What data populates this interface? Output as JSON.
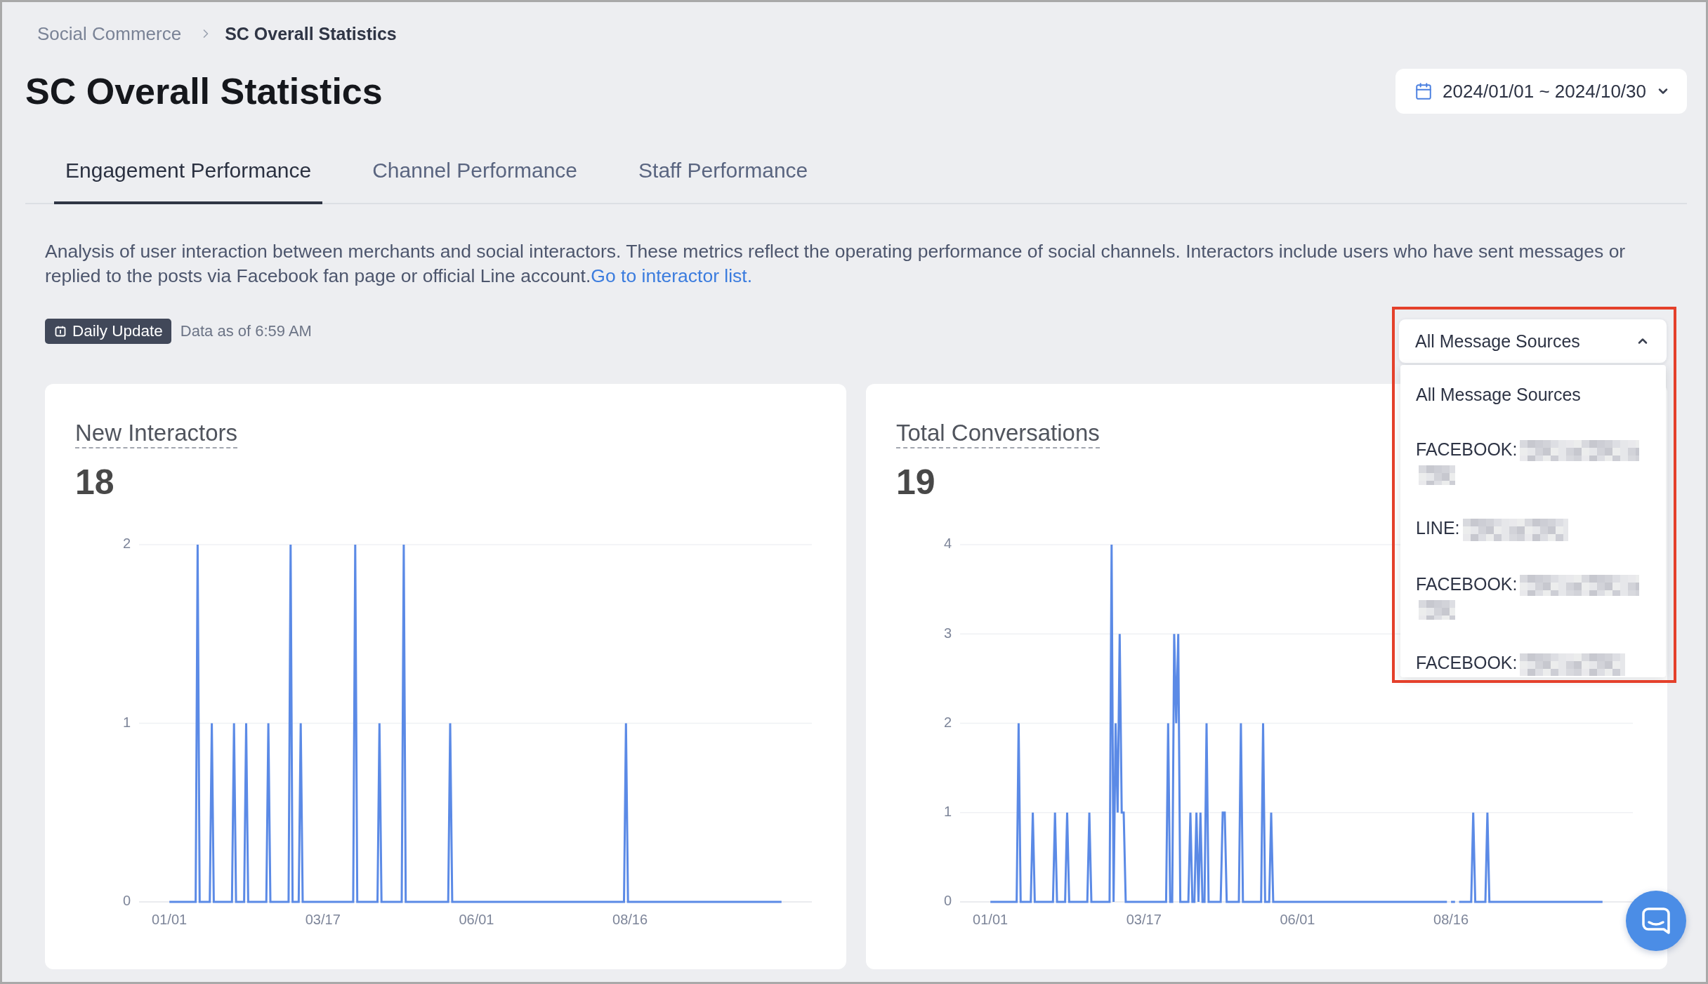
{
  "breadcrumb": [
    {
      "label": "Social Commerce",
      "current": false
    },
    {
      "label": "SC Overall Statistics",
      "current": true
    }
  ],
  "page_title": "SC Overall Statistics",
  "date_range": {
    "value": "2024/01/01 ~ 2024/10/30"
  },
  "tabs": [
    {
      "label": "Engagement Performance",
      "selected": true
    },
    {
      "label": "Channel Performance",
      "selected": false
    },
    {
      "label": "Staff Performance",
      "selected": false
    }
  ],
  "description": {
    "text": "Analysis of user interaction between merchants and social interactors. These metrics reflect the operating performance of social channels. Interactors include users who have sent messages or replied to the posts via Facebook fan page or official Line account.",
    "link": "Go to interactor list."
  },
  "update_badge": {
    "label": "Daily Update"
  },
  "data_timestamp": "Data as of 6:59 AM",
  "source_filter": {
    "value": "All Message Sources",
    "expanded": true,
    "highlighted": true,
    "options": [
      {
        "label": "All Message Sources",
        "kind": "plain"
      },
      {
        "label": "FACEBOOK:",
        "kind": "masked-wrapped"
      },
      {
        "label": "LINE:",
        "kind": "masked"
      },
      {
        "label": "FACEBOOK:",
        "kind": "masked-wrapped"
      },
      {
        "label": "FACEBOOK:",
        "kind": "masked"
      }
    ]
  },
  "metrics": [
    {
      "title": "New Interactors",
      "value": "18",
      "chart_data": {
        "type": "line",
        "color": "#5b8ae6",
        "grid": true,
        "xlim": [
          "2023-12-17",
          "2024-11-14"
        ],
        "ylim": [
          0,
          2
        ],
        "yticks": [
          0,
          1,
          2
        ],
        "xticks": [
          {
            "value": "2024-01-01",
            "label": "01/01"
          },
          {
            "value": "2024-03-17",
            "label": "03/17"
          },
          {
            "value": "2024-06-01",
            "label": "06/01"
          },
          {
            "value": "2024-08-16",
            "label": "08/16"
          }
        ],
        "x": [
          "2024-01-01",
          "2024-01-14",
          "2024-01-15",
          "2024-01-16",
          "2024-01-21",
          "2024-01-22",
          "2024-01-23",
          "2024-02-01",
          "2024-02-02",
          "2024-02-03",
          "2024-02-07",
          "2024-02-08",
          "2024-02-09",
          "2024-02-18",
          "2024-02-19",
          "2024-02-20",
          "2024-02-29",
          "2024-03-01",
          "2024-03-02",
          "2024-03-05",
          "2024-03-06",
          "2024-03-07",
          "2024-04-01",
          "2024-04-02",
          "2024-04-03",
          "2024-04-13",
          "2024-04-14",
          "2024-04-15",
          "2024-04-25",
          "2024-04-26",
          "2024-04-27",
          "2024-05-18",
          "2024-05-19",
          "2024-05-20",
          "2024-08-13",
          "2024-08-14",
          "2024-08-15",
          "2024-10-30"
        ],
        "values": [
          0,
          0,
          2,
          0,
          0,
          1,
          0,
          0,
          1,
          0,
          0,
          1,
          0,
          0,
          1,
          0,
          0,
          2,
          0,
          0,
          1,
          0,
          0,
          2,
          0,
          0,
          1,
          0,
          0,
          2,
          0,
          0,
          1,
          0,
          0,
          1,
          0,
          0
        ]
      }
    },
    {
      "title": "Total Conversations",
      "value": "19",
      "chart_data": {
        "type": "line",
        "color": "#5b8ae6",
        "grid": true,
        "xlim": [
          "2023-12-17",
          "2024-11-14"
        ],
        "ylim": [
          0,
          4
        ],
        "yticks": [
          0,
          1,
          2,
          3,
          4
        ],
        "xticks": [
          {
            "value": "2024-01-01",
            "label": "01/01"
          },
          {
            "value": "2024-03-17",
            "label": "03/17"
          },
          {
            "value": "2024-06-01",
            "label": "06/01"
          },
          {
            "value": "2024-08-16",
            "label": "08/16"
          }
        ],
        "x": [
          "2024-01-01",
          "2024-01-14",
          "2024-01-15",
          "2024-01-16",
          "2024-01-21",
          "2024-01-22",
          "2024-01-23",
          "2024-02-01",
          "2024-02-02",
          "2024-02-03",
          "2024-02-07",
          "2024-02-08",
          "2024-02-09",
          "2024-02-18",
          "2024-02-19",
          "2024-02-20",
          "2024-02-29",
          "2024-03-01",
          "2024-03-02",
          "2024-03-03",
          "2024-03-04",
          "2024-03-05",
          "2024-03-06",
          "2024-03-07",
          "2024-03-08",
          "2024-03-28",
          "2024-03-29",
          "2024-03-30",
          "2024-03-31",
          "2024-04-01",
          "2024-04-02",
          "2024-04-03",
          "2024-04-04",
          "2024-04-08",
          "2024-04-09",
          "2024-04-10",
          "2024-04-11",
          "2024-04-12",
          "2024-04-13",
          "2024-04-14",
          "2024-04-15",
          "2024-04-16",
          "2024-04-17",
          "2024-04-18",
          "2024-04-24",
          "2024-04-25",
          "2024-04-26",
          "2024-04-27",
          "2024-05-03",
          "2024-05-04",
          "2024-05-05",
          "2024-05-14",
          "2024-05-15",
          "2024-05-16",
          "2024-05-18",
          "2024-05-19",
          "2024-05-20",
          "2024-08-14",
          "2024-08-15",
          "2024-08-16",
          "2024-08-18",
          "2024-08-19",
          "2024-08-20",
          "2024-08-26",
          "2024-08-27",
          "2024-08-28",
          "2024-09-02",
          "2024-09-03",
          "2024-09-04",
          "2024-10-30"
        ],
        "values": [
          0,
          0,
          2,
          0,
          0,
          1,
          0,
          0,
          1,
          0,
          0,
          1,
          0,
          0,
          1,
          0,
          0,
          4,
          0,
          2,
          1,
          3,
          1,
          1,
          0,
          0,
          2,
          0,
          0,
          3,
          2,
          3,
          0,
          0,
          1,
          0,
          0,
          1,
          0,
          1,
          0,
          0,
          2,
          0,
          0,
          1,
          1,
          0,
          0,
          2,
          0,
          0,
          2,
          0,
          0,
          1,
          0,
          0,
          null,
          0,
          0,
          null,
          0,
          0,
          1,
          0,
          0,
          1,
          0,
          0
        ]
      }
    }
  ]
}
